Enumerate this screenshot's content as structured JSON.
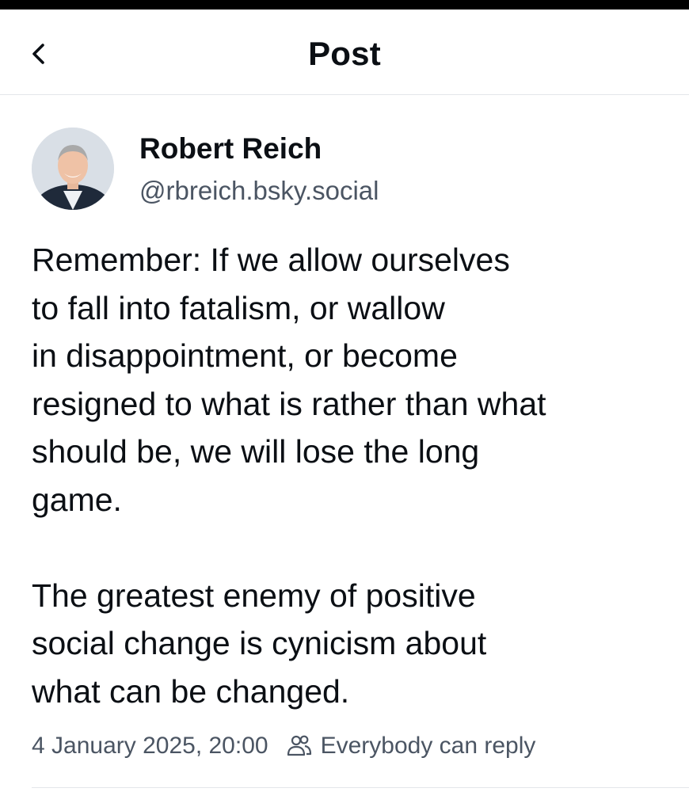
{
  "header": {
    "title": "Post",
    "back_icon": "chevron-left-icon"
  },
  "post": {
    "author": {
      "name": "Robert Reich",
      "handle": "@rbreich.bsky.social",
      "avatar": "avatar-photo"
    },
    "paragraphs": [
      "Remember: If we allow ourselves\nto fall into fatalism, or wallow\nin disappointment, or become\nresigned to what is rather than what\nshould be, we will lose the long\ngame.",
      "The greatest enemy of positive\nsocial change is cynicism about\nwhat can be changed."
    ],
    "timestamp": "4 January 2025, 20:00",
    "reply_setting": {
      "icon": "people-icon",
      "label": "Everybody can reply"
    }
  },
  "colors": {
    "text_primary": "#0b0f14",
    "text_secondary": "#4b5563",
    "divider": "#e3e6ea",
    "status_bar": "#000000"
  }
}
